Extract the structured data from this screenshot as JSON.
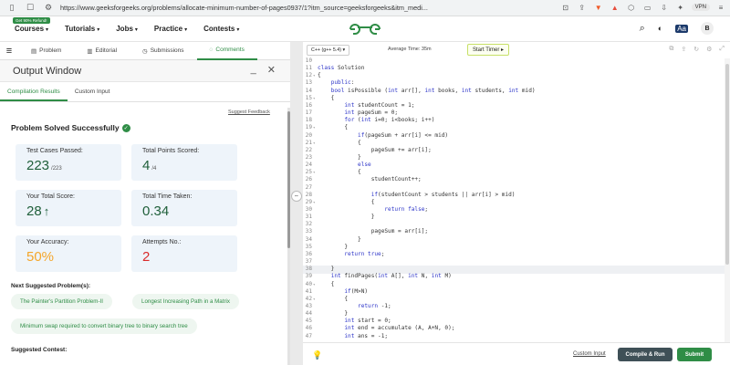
{
  "browser": {
    "url": "https://www.geeksforgeeks.org/problems/allocate-minimum-number-of-pages0937/1?itm_source=geeksforgeeks&itm_medi...",
    "vpn_label": "VPN"
  },
  "nav": {
    "badge": "Get 90% Refund!",
    "items": [
      "Courses",
      "Tutorials",
      "Jobs",
      "Practice",
      "Contests"
    ],
    "avatar_letter": "B"
  },
  "problem_tabs": [
    "Problem",
    "Editorial",
    "Submissions",
    "Comments"
  ],
  "output": {
    "title": "Output Window",
    "tabs": [
      "Compilation Results",
      "Custom Input"
    ],
    "suggest_feedback": "Suggest Feedback",
    "solved_text": "Problem Solved Successfully",
    "cards": {
      "test_cases_label": "Test Cases Passed:",
      "test_cases_value": "223",
      "test_cases_total": "/223",
      "points_label": "Total Points Scored:",
      "points_value": "4",
      "points_total": "/4",
      "score_label": "Your Total Score:",
      "score_value": "28",
      "time_label": "Total Time Taken:",
      "time_value": "0.34",
      "accuracy_label": "Your Accuracy:",
      "accuracy_value": "50%",
      "attempts_label": "Attempts No.:",
      "attempts_value": "2"
    },
    "next_label": "Next Suggested Problem(s):",
    "suggestions": [
      "The Painter's Partition Problem-II",
      "Longest Increasing Path in a Matrix",
      "Minimum swap required to convert binary tree to binary search tree"
    ],
    "contest_label": "Suggested Contest:"
  },
  "editor": {
    "language": "C++ (g++ 5.4)",
    "avg_time": "Average Time: 35m",
    "start_timer": "Start Timer",
    "lines": [
      {
        "n": "10",
        "t": ""
      },
      {
        "n": "11",
        "t": "class Solution"
      },
      {
        "n": "12",
        "t": "{"
      },
      {
        "n": "13",
        "t": "    public:"
      },
      {
        "n": "14",
        "t": "    bool isPossible (int arr[], int books, int students, int mid)"
      },
      {
        "n": "15",
        "t": "    {"
      },
      {
        "n": "16",
        "t": "        int studentCount = 1;"
      },
      {
        "n": "17",
        "t": "        int pageSum = 0;"
      },
      {
        "n": "18",
        "t": "        for (int i=0; i<books; i++)"
      },
      {
        "n": "19",
        "t": "        {"
      },
      {
        "n": "20",
        "t": "            if(pageSum + arr[i] <= mid)"
      },
      {
        "n": "21",
        "t": "            {"
      },
      {
        "n": "22",
        "t": "                pageSum += arr[i];"
      },
      {
        "n": "23",
        "t": "            }"
      },
      {
        "n": "24",
        "t": "            else"
      },
      {
        "n": "25",
        "t": "            {"
      },
      {
        "n": "26",
        "t": "                studentCount++;"
      },
      {
        "n": "27",
        "t": ""
      },
      {
        "n": "28",
        "t": "                if(studentCount > students || arr[i] > mid)"
      },
      {
        "n": "29",
        "t": "                {"
      },
      {
        "n": "30",
        "t": "                    return false;"
      },
      {
        "n": "31",
        "t": "                }"
      },
      {
        "n": "32",
        "t": ""
      },
      {
        "n": "33",
        "t": "                pageSum = arr[i];"
      },
      {
        "n": "34",
        "t": "            }"
      },
      {
        "n": "35",
        "t": "        }"
      },
      {
        "n": "36",
        "t": "        return true;"
      },
      {
        "n": "37",
        "t": ""
      },
      {
        "n": "38",
        "t": "    }"
      },
      {
        "n": "39",
        "t": "    int findPages(int A[], int N, int M)"
      },
      {
        "n": "40",
        "t": "    {"
      },
      {
        "n": "41",
        "t": "        if(M>N)"
      },
      {
        "n": "42",
        "t": "        {"
      },
      {
        "n": "43",
        "t": "            return -1;"
      },
      {
        "n": "44",
        "t": "        }"
      },
      {
        "n": "45",
        "t": "        int start = 0;"
      },
      {
        "n": "46",
        "t": "        int end = accumulate (A, A+N, 0);"
      },
      {
        "n": "47",
        "t": "        int ans = -1;"
      }
    ],
    "custom_input": "Custom Input",
    "compile_run": "Compile & Run",
    "submit": "Submit"
  }
}
